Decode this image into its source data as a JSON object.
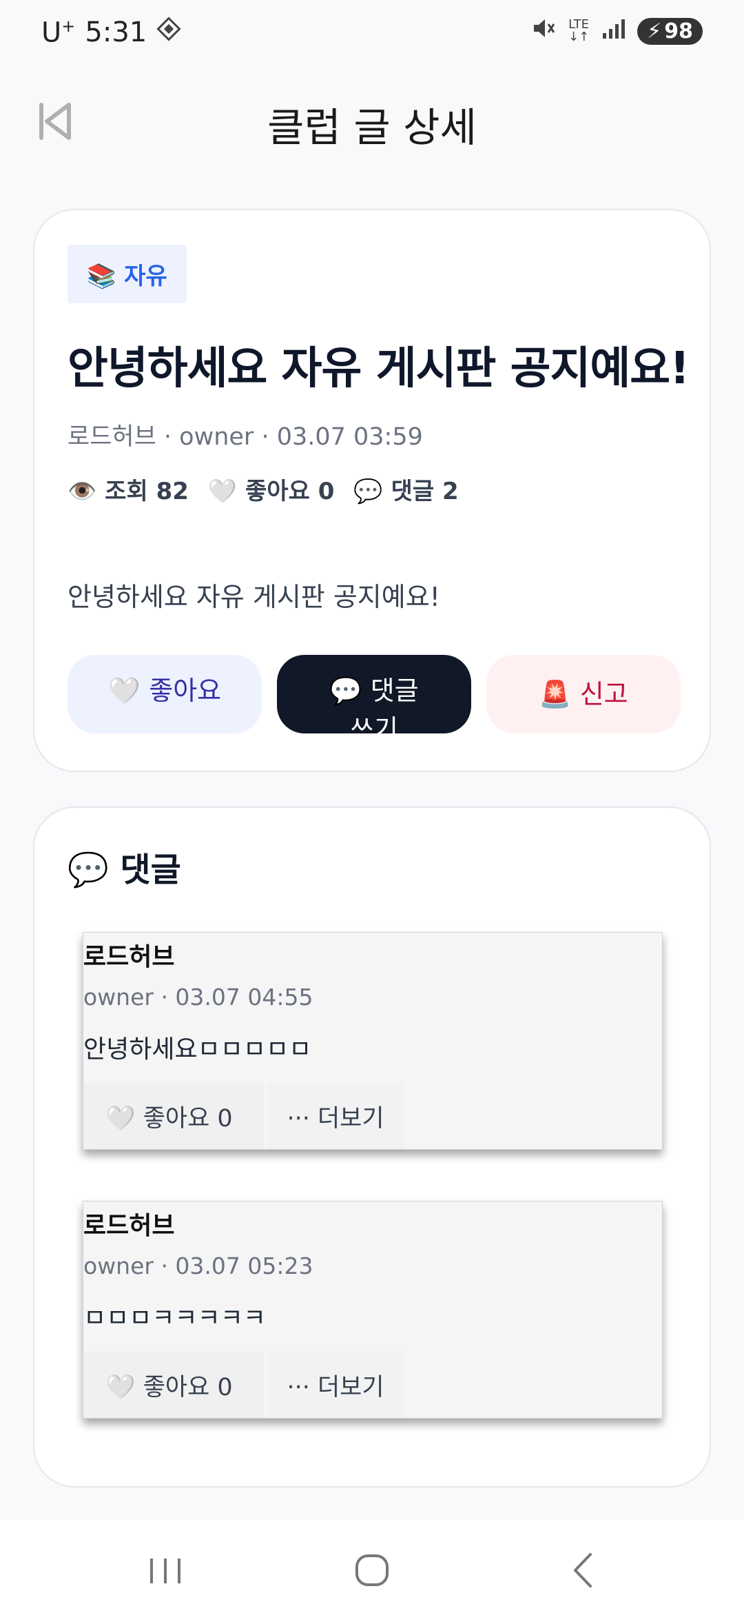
{
  "status_bar": {
    "carrier": "U",
    "carrier_sup": "+",
    "time": "5:31",
    "network": "LTE",
    "battery": "98"
  },
  "header": {
    "title": "클럽 글 상세"
  },
  "post": {
    "category": "📚 자유",
    "title": "안녕하세요 자유 게시판 공지예요!",
    "meta": "로드허브 · owner · 03.07 03:59",
    "stats": {
      "views": "👁️ 조회 82",
      "likes": "🤍 좋아요 0",
      "comments": "💬 댓글 2"
    },
    "body": "안녕하세요 자유 게시판 공지예요!",
    "actions": {
      "like": "🤍 좋아요",
      "comment": "💬 댓글 쓰기",
      "report": "🚨 신고"
    }
  },
  "comments_section": {
    "heading": "💬 댓글",
    "items": [
      {
        "author": "로드허브",
        "meta": "owner · 03.07 04:55",
        "text": "안녕하세요ㅁㅁㅁㅁㅁ",
        "like": "🤍 좋아요 0",
        "more": "··· 더보기"
      },
      {
        "author": "로드허브",
        "meta": "owner · 03.07 05:23",
        "text": "ㅁㅁㅁㅋㅋㅋㅋㅋ",
        "like": "🤍 좋아요 0",
        "more": "··· 더보기"
      }
    ]
  },
  "icons": {
    "back": "skip-back-icon",
    "recents": "recents-icon",
    "home": "home-icon",
    "nav_back": "chevron-left-icon"
  }
}
